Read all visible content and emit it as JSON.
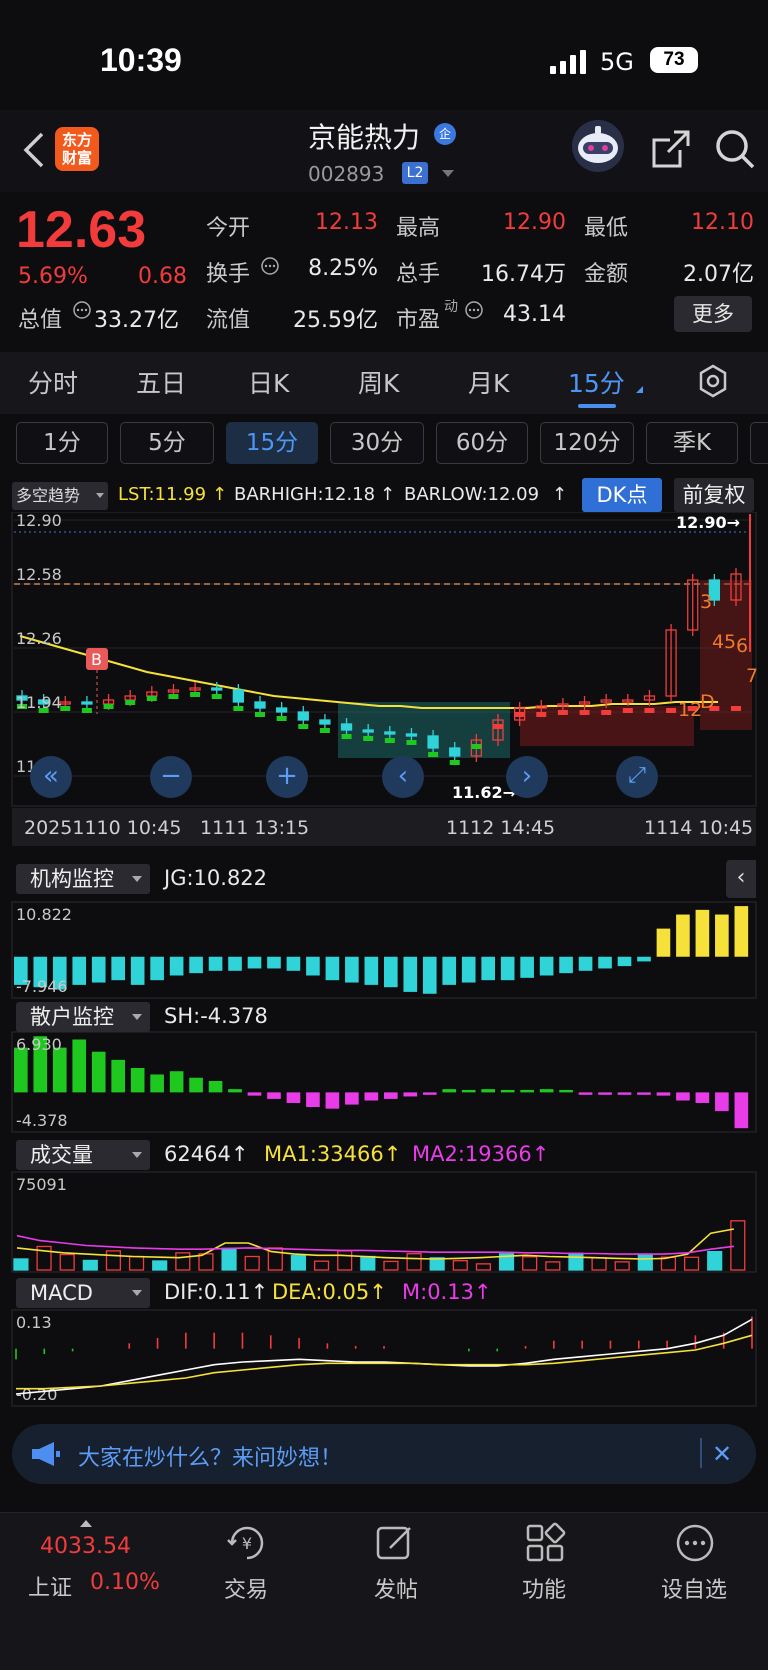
{
  "status_bar": {
    "time": "10:39",
    "network": "5G",
    "battery": "73"
  },
  "header": {
    "logo_text_line1": "东方",
    "logo_text_line2": "财富",
    "stock_name": "京能热力",
    "qi_badge": "企",
    "stock_code": "002893",
    "level_badge": "L2"
  },
  "quote": {
    "price": "12.63",
    "change_pct": "5.69%",
    "change_abs": "0.68",
    "open_label": "今开",
    "open_value": "12.13",
    "high_label": "最高",
    "high_value": "12.90",
    "low_label": "最低",
    "low_value": "12.10",
    "turnover_label": "换手",
    "turnover_value": "8.25%",
    "volume_label": "总手",
    "volume_value": "16.74万",
    "amount_label": "金额",
    "amount_value": "2.07亿",
    "total_mv_label": "总值",
    "total_mv_value": "33.27亿",
    "float_mv_label": "流值",
    "float_mv_value": "25.59亿",
    "pe_label": "市盈",
    "pe_sup": "动",
    "pe_value": "43.14",
    "more_label": "更多"
  },
  "period_tabs": [
    "分时",
    "五日",
    "日K",
    "周K",
    "月K",
    "15分"
  ],
  "active_period": "15分",
  "minute_buttons": [
    "1分",
    "5分",
    "15分",
    "30分",
    "60分",
    "120分",
    "季K"
  ],
  "active_minute": "15分",
  "main_indicator": {
    "selector": "多空趋势",
    "lst": "LST:11.99",
    "barhigh": "BARHIGH:12.18",
    "barlow": "BARLOW:12.09",
    "dk_button": "DK点",
    "adjust_button": "前复权"
  },
  "colors": {
    "up": "#f23c3c",
    "down": "#2fd3d8",
    "green": "#1ec81e",
    "yellow": "#f5e13a",
    "magenta": "#e83ce8",
    "accent": "#3b78e0"
  },
  "chart_data": [
    {
      "type": "candlestick",
      "panel": "price",
      "y_ticks": [
        "12.90",
        "12.58",
        "12.26",
        "11.94",
        "11.62"
      ],
      "ylim": [
        11.62,
        12.9
      ],
      "x_labels": [
        "20251110 10:45",
        "1111 13:15",
        "1112 14:45",
        "1114 10:45"
      ],
      "max_marker": "12.90→",
      "min_marker": "11.62→",
      "signal_labels": [
        "B",
        "3",
        "4",
        "5",
        "6",
        "7",
        "12",
        "D"
      ],
      "close": [
        12.0,
        11.98,
        11.99,
        11.98,
        12.0,
        12.02,
        12.04,
        12.05,
        12.06,
        12.05,
        11.99,
        11.96,
        11.94,
        11.9,
        11.88,
        11.85,
        11.84,
        11.83,
        11.82,
        11.76,
        11.72,
        11.8,
        11.9,
        11.96,
        11.97,
        11.98,
        11.99,
        12.0,
        12.0,
        12.02,
        12.35,
        12.6,
        12.5,
        12.63
      ],
      "series": [
        {
          "name": "LST",
          "values": [
            12.32,
            12.29,
            12.26,
            12.23,
            12.2,
            12.17,
            12.14,
            12.12,
            12.1,
            12.08,
            12.06,
            12.04,
            12.02,
            12.01,
            12.0,
            11.99,
            11.98,
            11.97,
            11.97,
            11.96,
            11.96,
            11.96,
            11.96,
            11.96,
            11.96,
            11.97,
            11.97,
            11.97,
            11.98,
            11.98,
            11.98,
            11.99,
            11.99,
            11.99
          ]
        }
      ]
    },
    {
      "type": "bar",
      "panel": "机构监控",
      "label": "JG:10.822",
      "y_ticks": [
        "10.822",
        "-7.946"
      ],
      "ylim": [
        -7.946,
        10.822
      ],
      "values": [
        -6,
        -6.5,
        -7,
        -6,
        -5.5,
        -5,
        -6,
        -5,
        -4,
        -3.5,
        -3,
        -3,
        -2.5,
        -2.5,
        -3,
        -4,
        -5,
        -5.5,
        -6,
        -6.5,
        -7.5,
        -7.9,
        -6,
        -5.5,
        -5,
        -5,
        -4.5,
        -4,
        -3.5,
        -3,
        -2.5,
        -2,
        -1,
        6,
        9,
        10,
        9,
        10.8
      ]
    },
    {
      "type": "bar",
      "panel": "散户监控",
      "label": "SH:-4.378",
      "y_ticks": [
        "6.930",
        "-4.378"
      ],
      "ylim": [
        -4.378,
        6.93
      ],
      "values": [
        5.5,
        6.9,
        5.5,
        6.5,
        5,
        4,
        3,
        2.2,
        2.6,
        1.8,
        1.4,
        0.4,
        -0.4,
        -0.8,
        -1.3,
        -1.8,
        -2,
        -1.5,
        -1,
        -0.8,
        -0.5,
        -0.3,
        0.4,
        0.3,
        0.4,
        0.3,
        0.3,
        0.4,
        0.3,
        -0.3,
        -0.3,
        -0.3,
        -0.3,
        -0.4,
        -1,
        -1.3,
        -2.3,
        -4.4
      ]
    },
    {
      "type": "bar",
      "panel": "成交量",
      "label": "62464",
      "y_ticks": [
        "75091"
      ],
      "ylim": [
        0,
        75091
      ],
      "series": [
        {
          "name": "MA1:33466",
          "values": [
            18000,
            16000,
            14000,
            13000,
            12000,
            11000,
            10500,
            10000,
            12000,
            22000,
            22000,
            15000,
            13000,
            12000,
            12000,
            11000,
            10000,
            9500,
            9000,
            9500,
            10000,
            11000,
            12000,
            11000,
            10500,
            10000,
            9500,
            9000,
            9500,
            13000,
            30000,
            33466
          ]
        },
        {
          "name": "MA2:19366",
          "values": [
            28000,
            24000,
            22000,
            20000,
            19000,
            18000,
            17500,
            17000,
            17000,
            17500,
            18000,
            17500,
            17000,
            16500,
            16000,
            16000,
            15500,
            15000,
            14500,
            14500,
            14500,
            14500,
            14000,
            14000,
            13500,
            13500,
            13000,
            13000,
            13000,
            14000,
            17000,
            19366
          ]
        }
      ]
    },
    {
      "type": "line",
      "panel": "MACD",
      "y_ticks": [
        "0.13",
        "-0.20"
      ],
      "ylim": [
        -0.2,
        0.13
      ],
      "series": [
        {
          "name": "DIF:0.11",
          "values": [
            -0.17,
            -0.16,
            -0.15,
            -0.14,
            -0.12,
            -0.1,
            -0.08,
            -0.06,
            -0.05,
            -0.045,
            -0.04,
            -0.045,
            -0.05,
            -0.05,
            -0.055,
            -0.06,
            -0.065,
            -0.065,
            -0.055,
            -0.04,
            -0.03,
            -0.02,
            -0.01,
            0.0,
            0.02,
            0.05,
            0.11
          ]
        },
        {
          "name": "DEA:0.05",
          "values": [
            -0.15,
            -0.15,
            -0.145,
            -0.14,
            -0.13,
            -0.12,
            -0.11,
            -0.09,
            -0.08,
            -0.07,
            -0.06,
            -0.055,
            -0.055,
            -0.055,
            -0.055,
            -0.06,
            -0.06,
            -0.06,
            -0.06,
            -0.055,
            -0.045,
            -0.035,
            -0.025,
            -0.015,
            -0.005,
            0.02,
            0.05
          ]
        },
        {
          "name": "M:0.13",
          "values": []
        }
      ]
    }
  ],
  "sub_panels": {
    "jg_selector": "机构监控",
    "jg_label": "JG:10.822",
    "sh_selector": "散户监控",
    "sh_label": "SH:-4.378",
    "vol_selector": "成交量",
    "vol_label": "62464",
    "vol_ma1": "MA1:33466",
    "vol_ma2": "MA2:19366",
    "macd_selector": "MACD",
    "macd_dif": "DIF:0.11",
    "macd_dea": "DEA:0.05",
    "macd_m": "M:0.13"
  },
  "banner": {
    "text": "大家在炒什么？来问妙想！"
  },
  "tabbar": {
    "index_value": "4033.54",
    "index_name": "上证",
    "index_change": "0.10%",
    "items": [
      "交易",
      "发帖",
      "功能",
      "设自选"
    ]
  }
}
